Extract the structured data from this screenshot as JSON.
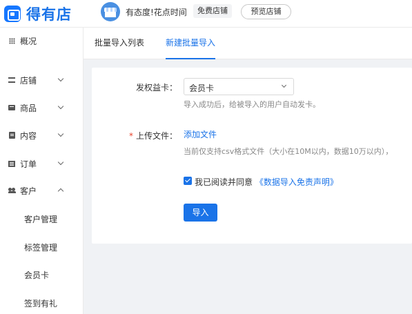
{
  "header": {
    "logo_text": "得有店",
    "shop_name": "有态度!花点时间",
    "free_badge": "免费店铺",
    "preview_button": "预览店铺"
  },
  "sidebar": {
    "items": [
      {
        "label": "概况",
        "icon": "grid-icon"
      },
      {
        "label": "店铺",
        "icon": "store-icon"
      },
      {
        "label": "商品",
        "icon": "goods-icon"
      },
      {
        "label": "内容",
        "icon": "content-icon"
      },
      {
        "label": "订单",
        "icon": "order-icon"
      },
      {
        "label": "客户",
        "icon": "users-icon"
      }
    ],
    "customer_subitems": [
      "客户管理",
      "标签管理",
      "会员卡",
      "签到有礼"
    ]
  },
  "tabs": [
    {
      "label": "批量导入列表",
      "active": false
    },
    {
      "label": "新建批量导入",
      "active": true
    }
  ],
  "form": {
    "card_label": "发权益卡：",
    "card_value": "会员卡",
    "card_hint": "导入成功后，给被导入的用户自动发卡。",
    "upload_label": "上传文件：",
    "upload_required_mark": "*",
    "upload_link": "添加文件",
    "upload_hint": "当前仅支持csv格式文件（大小在10M以内，数据10万以内），",
    "agree_text": "我已阅读并同意",
    "agree_link": "《数据导入免责声明》",
    "agree_checked": true,
    "import_button": "导入"
  },
  "colors": {
    "accent": "#1a73e8",
    "required": "#e8442c",
    "page_bg": "#f0f2f5"
  }
}
